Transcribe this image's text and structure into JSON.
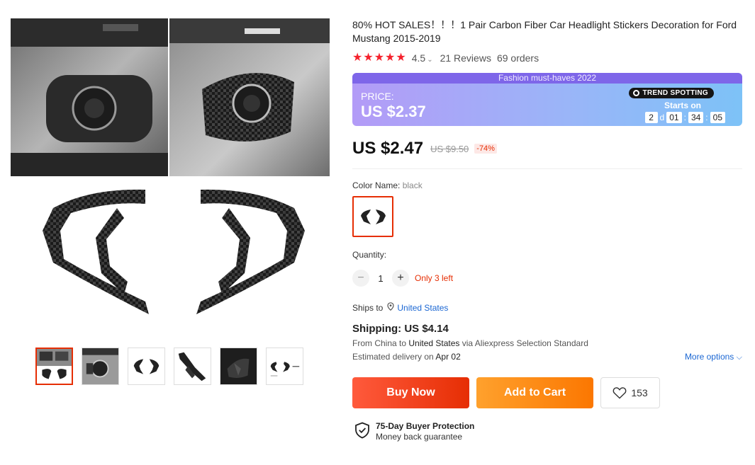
{
  "product": {
    "title": "80% HOT SALES！！！1 Pair Carbon Fiber Car Headlight Stickers Decoration for Ford Mustang 2015-2019",
    "rating": "4.5",
    "reviews": "21 Reviews",
    "orders": "69 orders"
  },
  "promo": {
    "banner": "Fashion must-haves 2022",
    "price_label": "PRICE:",
    "price": "US $2.37",
    "badge": "TREND SPOTTING",
    "starts_on": "Starts on",
    "days": "2",
    "day_unit": "d",
    "hours": "01",
    "minutes": "34",
    "seconds": "05",
    "colors": {
      "banner": "#7e66e9",
      "gradient_start": "#b39bf7",
      "gradient_end": "#7dc2f7"
    }
  },
  "pricing": {
    "price": "US $2.47",
    "original": "US $9.50",
    "discount": "-74%"
  },
  "color": {
    "label": "Color Name:",
    "value": "black"
  },
  "quantity": {
    "label": "Quantity:",
    "minus": "−",
    "plus": "+",
    "value": "1",
    "stock": "Only 3 left"
  },
  "ships": {
    "label": "Ships to",
    "country": "United States",
    "pin_icon": "location-pin-icon"
  },
  "shipping": {
    "price_text": "Shipping: US $4.14",
    "from_prefix": "From China to",
    "to": "United States",
    "via": "via Aliexpress Selection Standard",
    "estimate_prefix": "Estimated delivery on",
    "estimate_date": "Apr 02",
    "more_options": "More options"
  },
  "actions": {
    "buy_now": "Buy Now",
    "add_to_cart": "Add to Cart",
    "wishlist_count": "153",
    "colors": {
      "buy": "#e62e04",
      "cart": "#fb7701"
    }
  },
  "protection": {
    "title": "75-Day Buyer Protection",
    "subtitle": "Money back guarantee"
  },
  "gallery": {
    "thumb_count": 6
  }
}
